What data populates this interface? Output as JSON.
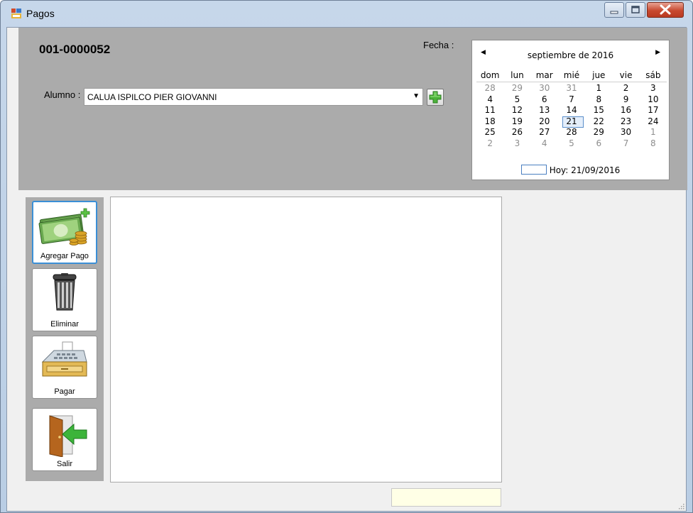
{
  "window": {
    "title": "Pagos",
    "icon": "app-form-icon"
  },
  "header": {
    "voucher_number": "001-0000052",
    "fecha_label": "Fecha :",
    "alumno_label": "Alumno :",
    "alumno_value": "CALUA ISPILCO PIER GIOVANNI",
    "add_alumno_icon": "green-plus-icon"
  },
  "calendar": {
    "month_title": "septiembre de 2016",
    "weekdays": [
      "dom",
      "lun",
      "mar",
      "mié",
      "jue",
      "vie",
      "sáb"
    ],
    "weeks": [
      [
        "28",
        "29",
        "30",
        "31",
        "1",
        "2",
        "3"
      ],
      [
        "4",
        "5",
        "6",
        "7",
        "8",
        "9",
        "10"
      ],
      [
        "11",
        "12",
        "13",
        "14",
        "15",
        "16",
        "17"
      ],
      [
        "18",
        "19",
        "20",
        "21",
        "22",
        "23",
        "24"
      ],
      [
        "25",
        "26",
        "27",
        "28",
        "29",
        "30",
        "1"
      ],
      [
        "2",
        "3",
        "4",
        "5",
        "6",
        "7",
        "8"
      ]
    ],
    "selected_day": "21",
    "today_text": "Hoy: 21/09/2016"
  },
  "actions": {
    "add_payment": "Agregar Pago",
    "delete": "Eliminar",
    "pay": "Pagar",
    "exit": "Salir"
  },
  "colors": {
    "panel": "#ababab",
    "accent": "#3b8fd6",
    "total_field": "#ffffe6"
  }
}
